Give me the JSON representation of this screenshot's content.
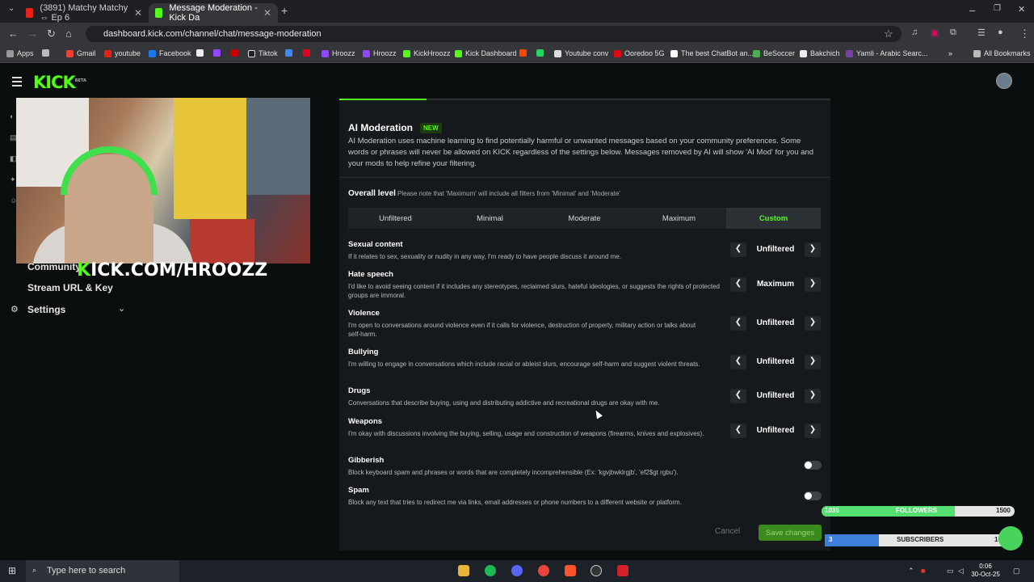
{
  "browser": {
    "tabs": [
      {
        "label": "(3891) Matchy Matchy ⇔ Ep 6",
        "active": false
      },
      {
        "label": "Message Moderation - Kick Da",
        "active": true
      }
    ],
    "url": "dashboard.kick.com/channel/chat/message-moderation",
    "bookmarks": [
      "Apps",
      "Gmail",
      "youtube",
      "Facebook",
      "Tiktok",
      "Hroozz",
      "Hroozz",
      "KickHroozz",
      "Kick Dashboard",
      "Youtube conv",
      "Ooredoo 5G",
      "The best ChatBot an...",
      "BeSoccer",
      "Bakchich",
      "Yamli - Arabic Searc...",
      "All Bookmarks"
    ]
  },
  "header": {
    "logo": "KICK",
    "logo_sup": "BETA"
  },
  "stream_overlay": {
    "handle_prefix": "K",
    "handle_rest": "ICK.COM/HROOZZ"
  },
  "sidebar": {
    "items": [
      {
        "label": "Community"
      },
      {
        "label": "Stream URL & Key"
      },
      {
        "label": "Settings"
      }
    ]
  },
  "moderation": {
    "title": "AI Moderation",
    "badge": "NEW",
    "description": "AI Moderation uses machine learning to find potentially harmful or unwanted messages based on your community preferences. Some words or phrases will never be allowed on KICK regardless of the settings below. Messages removed by AI will show 'AI Mod' for you and your mods to help refine your filtering.",
    "overall_label": "Overall level",
    "overall_note": "Please note that 'Maximum' will include all filters from 'Minimal' and 'Moderate'",
    "levels": [
      "Unfiltered",
      "Minimal",
      "Moderate",
      "Maximum",
      "Custom"
    ],
    "active_level": "Custom",
    "categories": [
      {
        "title": "Sexual content",
        "desc": "If it relates to sex, sexuality or nudity in any way, I'm ready to have people discuss it around me.",
        "value": "Unfiltered"
      },
      {
        "title": "Hate speech",
        "desc": "I'd like to avoid seeing content if it includes any stereotypes, reclaimed slurs, hateful ideologies, or suggests the rights of protected groups are immoral.",
        "value": "Maximum"
      },
      {
        "title": "Violence",
        "desc": "I'm open to conversations around violence even if it calls for violence, destruction of property, military action or talks about self-harm.",
        "value": "Unfiltered"
      },
      {
        "title": "Bullying",
        "desc": "I'm willing to engage in conversations which include racial or ableist slurs, encourage self-harm and suggest violent threats.",
        "value": "Unfiltered"
      },
      {
        "title": "Drugs",
        "desc": "Conversations that describe buying, using and distributing addictive and recreational drugs are okay with me.",
        "value": "Unfiltered"
      },
      {
        "title": "Weapons",
        "desc": "I'm okay with discussions involving the buying, selling, usage and construction of weapons (firearms, knives and explosives).",
        "value": "Unfiltered"
      }
    ],
    "toggles": [
      {
        "title": "Gibberish",
        "desc": "Block keyboard spam and phrases or words that are completely incomprehensible (Ex: 'kgvjbwklrgjb', 'ef2$gt rgbu').",
        "on": false
      },
      {
        "title": "Spam",
        "desc": "Block any text that tries to redirect me via links, email addresses or phone numbers to a different website or platform.",
        "on": false
      }
    ],
    "cancel_label": "Cancel",
    "save_label": "Save changes"
  },
  "goals": {
    "followers": {
      "current": "1035",
      "label": "FOLLOWERS",
      "target": "1500",
      "progress": 0.69
    },
    "subscribers": {
      "current": "3",
      "label": "SUBSCRIBERS",
      "target": "10",
      "progress": 0.3
    }
  },
  "taskbar": {
    "search_placeholder": "Type here to search",
    "time": "0:06",
    "date": "30-Oct-25"
  }
}
